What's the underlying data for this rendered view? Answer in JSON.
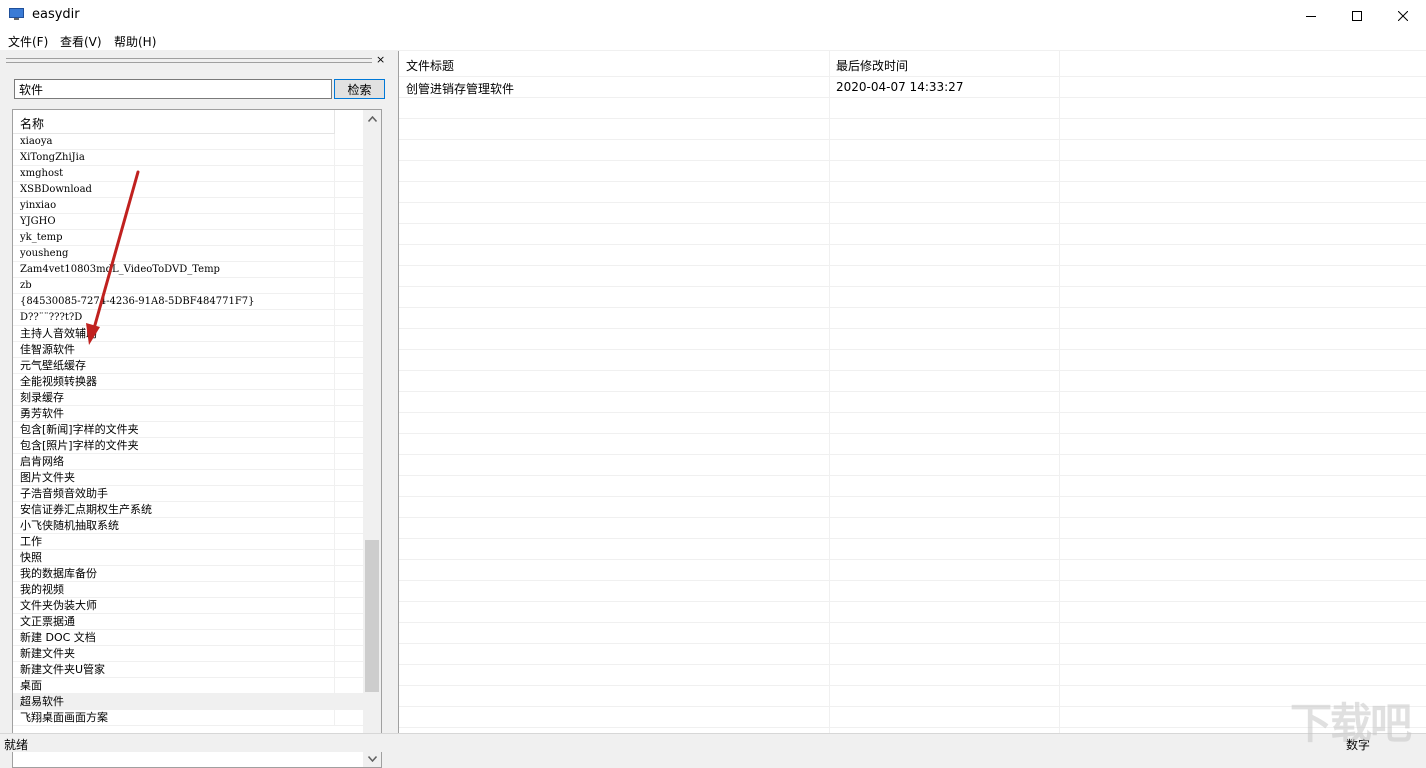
{
  "window": {
    "title": "easydir",
    "controls": [
      "minimize-icon",
      "maximize-icon",
      "close-icon"
    ]
  },
  "menu": [
    "文件(F)",
    "查看(V)",
    "帮助(H)"
  ],
  "left": {
    "close_glyph": "×",
    "search_value": "软件",
    "search_button": "检索",
    "column_header": "名称",
    "items": [
      "xiaoya",
      "XiTongZhiJia",
      "xmghost",
      "XSBDownload",
      "yinxiao",
      "YJGHO",
      "yk_temp",
      "yousheng",
      "Zam4vet10803mdL_VideoToDVD_Temp",
      "zb",
      "{84530085-7274-4236-91A8-5DBF484771F7}",
      "D??¨¨???t?D",
      "主持人音效辅助",
      "佳智源软件",
      "元气壁纸缓存",
      "全能视频转换器",
      "刻录缓存",
      "勇芳软件",
      "包含[新闻]字样的文件夹",
      "包含[照片]字样的文件夹",
      "启肯网络",
      "图片文件夹",
      "子浩音频音效助手",
      "安信证券汇点期权生产系统",
      "小飞侠随机抽取系统",
      "工作",
      "快照",
      "我的数据库备份",
      "我的视频",
      "文件夹伪装大师",
      "文正票据通",
      "新建 DOC 文档",
      "新建文件夹",
      "新建文件夹U管家",
      "桌面",
      "超易软件",
      "飞翔桌面画面方案"
    ],
    "selected_index": 35
  },
  "right": {
    "headers": [
      "文件标题",
      "最后修改时间"
    ],
    "rows": [
      [
        "创管进销存管理软件",
        "2020-04-07 14:33:27"
      ]
    ]
  },
  "status": {
    "left": "就绪",
    "right": "数字"
  },
  "watermark": "下载吧",
  "colors": {
    "accent_border": "#0078d7",
    "annotation_arrow": "#c0211f"
  }
}
